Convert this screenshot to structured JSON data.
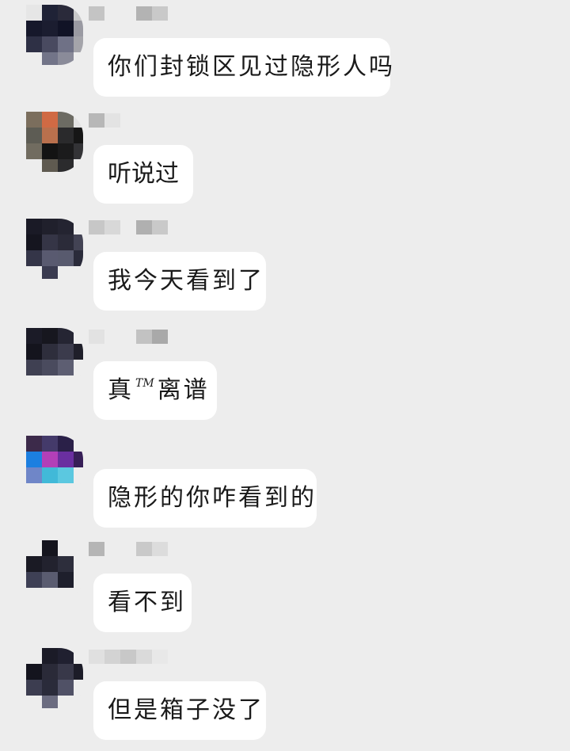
{
  "messages": [
    {
      "text": "你们封锁区见过隐形人吗"
    },
    {
      "text": "听说过"
    },
    {
      "text": "我今天看到了"
    },
    {
      "text_before": "真",
      "superscript": "TM",
      "text_after": "离谱"
    },
    {
      "text": "隐形的你咋看到的"
    },
    {
      "text": "看不到"
    },
    {
      "text": "但是箱子没了"
    }
  ],
  "colors": {
    "background": "#ededed",
    "bubble": "#ffffff",
    "text": "#1a1a1a"
  }
}
